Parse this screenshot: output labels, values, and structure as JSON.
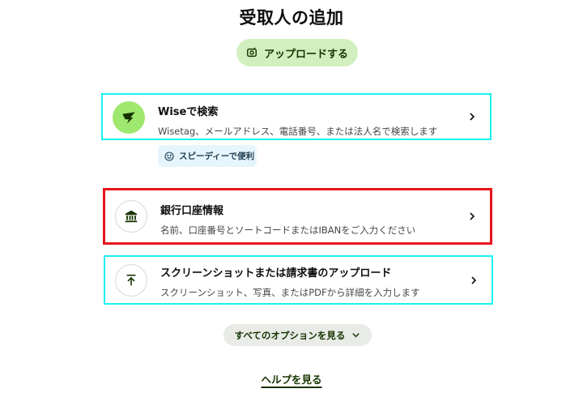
{
  "page": {
    "title": "受取人の追加"
  },
  "upload_button": {
    "label": "アップロードする",
    "icon": "upload-photo-icon"
  },
  "options": [
    {
      "id": "wise",
      "title": "Wiseで検索",
      "subtitle": "Wisetag、メールアドレス、電話番号、または法人名で検索します",
      "icon": "wise-logo-icon",
      "badge": {
        "label": "スピーディーで便利",
        "icon": "smile-icon"
      }
    },
    {
      "id": "bank",
      "title": "銀行口座情報",
      "subtitle": "名前、口座番号とソートコードまたはIBANをご入力ください",
      "icon": "bank-icon"
    },
    {
      "id": "screenshot",
      "title": "スクリーンショットまたは請求書のアップロード",
      "subtitle": "スクリーンショット、写真、またはPDFから詳細を入力します",
      "icon": "upload-arrow-icon"
    }
  ],
  "more_options": {
    "label": "すべてのオプションを見る",
    "icon": "chevron-down-icon"
  },
  "help": {
    "label": "ヘルプを見る"
  },
  "colors": {
    "wise_green": "#9fe870",
    "upload_bg": "#d2f0bf",
    "highlight_cyan": "#18f2f2",
    "highlight_red": "#e8141c",
    "badge_bg": "#e6f5fb",
    "dark_green": "#163300"
  }
}
